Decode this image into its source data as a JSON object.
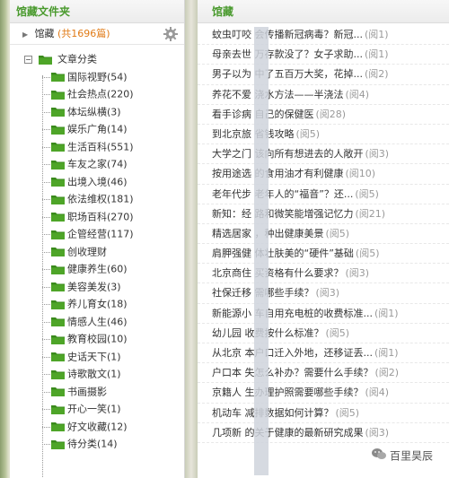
{
  "left": {
    "title": "馆藏文件夹",
    "root": {
      "label": "馆藏",
      "count": "(共1696篇)"
    },
    "category_root": "文章分类",
    "categories": [
      "国际视野(54)",
      "社会热点(220)",
      "体坛纵横(3)",
      "娱乐广角(14)",
      "生活百科(551)",
      "车友之家(74)",
      "出境入境(46)",
      "依法维权(181)",
      "职场百科(270)",
      "企管经营(117)",
      "创收理财",
      "健康养生(60)",
      "美容美发(3)",
      "养儿育女(18)",
      "情感人生(46)",
      "教育校园(10)",
      "史话天下(1)",
      "诗歌散文(1)",
      "书画摄影",
      "开心一笑(1)",
      "好文收藏(12)",
      "待分类(14)"
    ]
  },
  "right": {
    "title": "馆藏",
    "items": [
      {
        "title": "蚊虫叮咬      会传播新冠病毒？新冠...",
        "reads": "(阅1)"
      },
      {
        "title": "母亲去世      万存款没了？女子求助...",
        "reads": "(阅1)"
      },
      {
        "title": "男子以为      中了五百万大奖，花掉...",
        "reads": "(阅2)"
      },
      {
        "title": "养花不爱      浇水方法——半浇法",
        "reads": "(阅4)"
      },
      {
        "title": "看手诊病      自己的保健医",
        "reads": "(阅28)"
      },
      {
        "title": "到北京旅      省钱攻略",
        "reads": "(阅5)"
      },
      {
        "title": "大学之门      该向所有想进去的人敞开",
        "reads": "(阅3)"
      },
      {
        "title": "按用途选      的食用油才有利健康",
        "reads": "(阅10)"
      },
      {
        "title": "老年代步      老年人的“福音”？还...",
        "reads": "(阅5)"
      },
      {
        "title": "新知：经      路和微笑能增强记忆力",
        "reads": "(阅21)"
      },
      {
        "title": "精选居家      ，种出健康美景",
        "reads": "(阅5)"
      },
      {
        "title": "肩胛强健      体壮肤美的“硬件”基础",
        "reads": "(阅5)"
      },
      {
        "title": "北京商住      买资格有什么要求？",
        "reads": "(阅3)"
      },
      {
        "title": "社保迁移      需哪些手续？",
        "reads": "(阅3)"
      },
      {
        "title": "新能源小      车自用充电桩的收费标准...",
        "reads": "(阅1)"
      },
      {
        "title": "幼儿园      收费按什么标准？",
        "reads": "(阅5)"
      },
      {
        "title": "从北京      本户口迁入外地，还移证丢...",
        "reads": "(阅1)"
      },
      {
        "title": "户口本      失怎么补办？需要什么手续？",
        "reads": "(阅2)"
      },
      {
        "title": "京籍人      生办理护照需要哪些手续？",
        "reads": "(阅4)"
      },
      {
        "title": "机动车      减排数据如何计算？",
        "reads": "(阅5)"
      },
      {
        "title": "几项新      的关于健康的最新研究成果",
        "reads": "(阅3)"
      }
    ]
  },
  "watermark": "百里昊辰",
  "colors": {
    "title_green": "#4a9a2e",
    "count_orange": "#e07a15",
    "folder_green": "#3a8a1c",
    "read_gray": "#999999"
  },
  "icons": [
    "gear-icon",
    "expand-arrow-icon",
    "collapse-minus-icon",
    "folder-icon",
    "wechat-logo-icon"
  ]
}
